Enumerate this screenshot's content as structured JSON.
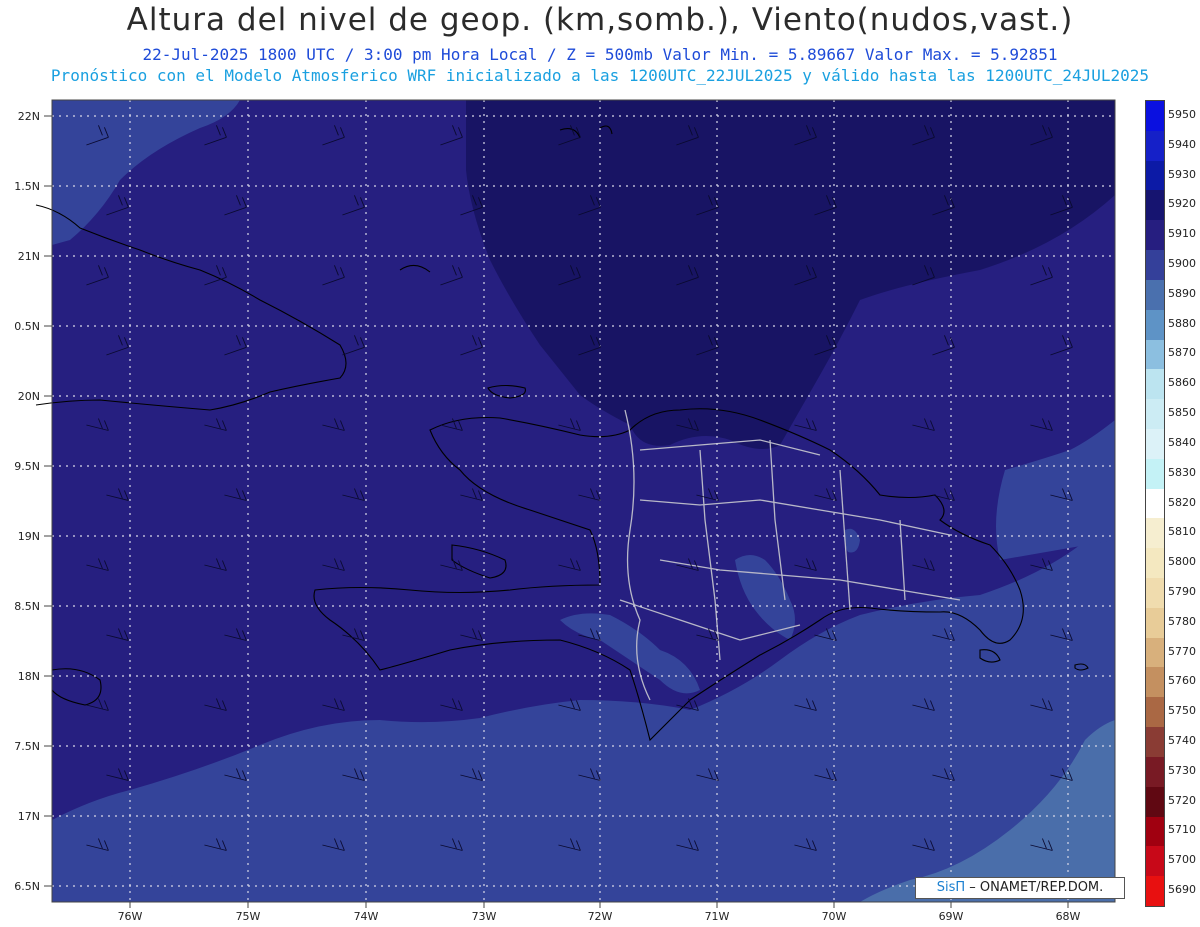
{
  "header": {
    "title": "Altura del nivel de geop. (km,somb.), Viento(nudos,vast.)",
    "subtitle": "22-Jul-2025   1800 UTC / 3:00 pm Hora Local / Z = 500mb    Valor Min. = 5.89667  Valor Max. = 5.92851",
    "forecast_note": "Pronóstico con el Modelo Atmosferico WRF inicializado a las 1200UTC_22JUL2025 y válido hasta las  1200UTC_24JUL2025"
  },
  "axes": {
    "lat_labels": [
      "22N",
      "1.5N",
      "21N",
      "0.5N",
      "20N",
      "9.5N",
      "19N",
      "8.5N",
      "18N",
      "7.5N",
      "17N",
      "6.5N"
    ],
    "lon_labels": [
      "76W",
      "75W",
      "74W",
      "73W",
      "72W",
      "71W",
      "70W",
      "69W",
      "68W"
    ]
  },
  "colorbar": {
    "labels": [
      "5950",
      "5940",
      "5930",
      "5920",
      "5910",
      "5900",
      "5890",
      "5880",
      "5870",
      "5860",
      "5850",
      "5840",
      "5830",
      "5820",
      "5810",
      "5800",
      "5790",
      "5780",
      "5770",
      "5760",
      "5750",
      "5740",
      "5730",
      "5720",
      "5710",
      "5700",
      "5690"
    ],
    "colors": [
      "#0a10e0",
      "#1520c8",
      "#0c1aa6",
      "#161470",
      "#261e80",
      "#34409a",
      "#4a70ae",
      "#5e93c6",
      "#8cbfe0",
      "#bce4f0",
      "#ccecf4",
      "#dcf2f8",
      "#c4f2f6",
      "#ffffff",
      "#f6eed0",
      "#f4e8c0",
      "#f0dcae",
      "#e8cc98",
      "#d8b07c",
      "#c49060",
      "#aa6844",
      "#8a3c34",
      "#781a24",
      "#600812",
      "#a00010",
      "#c80818",
      "#e81010"
    ]
  },
  "credit": {
    "logo": "SisΠ",
    "text": "– ONAMET/REP.DOM."
  },
  "colors": {
    "field_dark": "#181464",
    "field_mid": "#261f80",
    "field_light": "#34449a",
    "field_lighter": "#4a6eaa"
  }
}
